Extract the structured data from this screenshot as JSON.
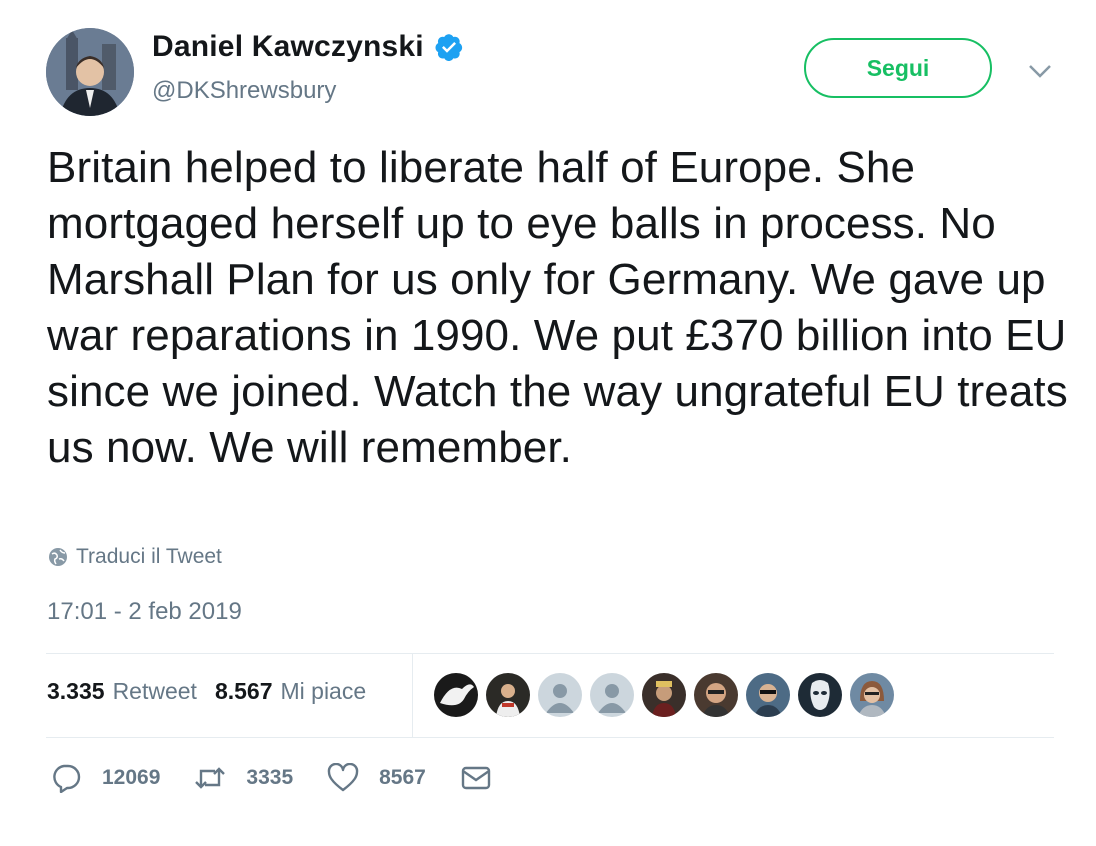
{
  "author": {
    "name": "Daniel Kawczynski",
    "handle": "@DKShrewsbury",
    "verified": true
  },
  "follow_label": "Segui",
  "text": "Britain helped to liberate half of Europe. She mortgaged herself up to eye balls in process. No Marshall Plan for us only for Germany. We gave up war reparations in 1990. We put £370 billion into EU since we joined. Watch the way ungrateful EU treats us now. We will remember.",
  "translate_label": "Traduci il Tweet",
  "timestamp": "17:01 - 2 feb 2019",
  "stats": {
    "retweets_count": "3.335",
    "retweets_label": "Retweet",
    "likes_count": "8.567",
    "likes_label": "Mi piace"
  },
  "actions": {
    "reply_count": "12069",
    "retweet_count": "3335",
    "like_count": "8567"
  },
  "colors": {
    "accent_green": "#17bf63",
    "verified_blue": "#1da1f2",
    "muted_text": "#657786"
  },
  "icons": [
    "verified-badge-icon",
    "chevron-down-icon",
    "globe-icon",
    "reply-icon",
    "retweet-icon",
    "heart-icon",
    "message-icon"
  ]
}
